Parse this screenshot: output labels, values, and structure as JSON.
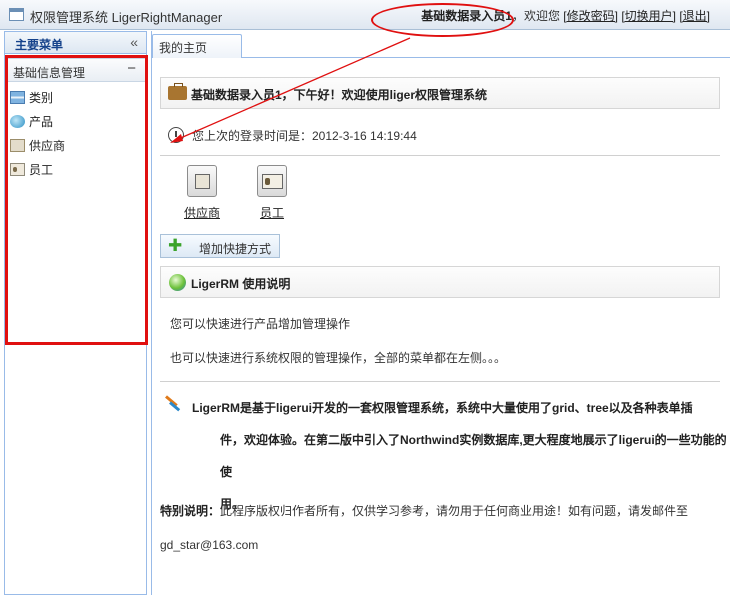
{
  "titlebar": {
    "app_title": "权限管理系统 LigerRightManager",
    "user_name": "基础数据录入员1",
    "welcome": "，欢迎您",
    "change_password": "[修改密码]",
    "switch_user": "[切换用户]",
    "logout": "[退出]"
  },
  "sidebar": {
    "title": "主要菜单",
    "collapse_glyph": "«",
    "group_title": "基础信息管理",
    "group_toggle": "−",
    "items": [
      {
        "label": "类别",
        "icon": "category-icon"
      },
      {
        "label": "产品",
        "icon": "product-icon"
      },
      {
        "label": "供应商",
        "icon": "supplier-icon"
      },
      {
        "label": "员工",
        "icon": "employee-icon"
      }
    ]
  },
  "main": {
    "tab_label": "我的主页",
    "greeting": "基础数据录入员1，下午好！欢迎使用liger权限管理系统",
    "last_login": "您上次的登录时间是：2012-3-16 14:19:44",
    "shortcuts": [
      {
        "label": "供应商",
        "icon": "supplier-icon"
      },
      {
        "label": "员工",
        "icon": "employee-icon"
      }
    ],
    "add_shortcut_label": "增加快捷方式",
    "usage_title": "LigerRM 使用说明",
    "usage_lines": [
      "您可以快速进行产品增加管理操作",
      "也可以快速进行系统权限的管理操作，全部的菜单都在左侧。。。"
    ],
    "intro_lines": [
      "LigerRM是基于ligerui开发的一套权限管理系统，系统中大量使用了grid、tree以及各种表单插",
      "件，欢迎体验。在第二版中引入了Northwind实例数据库,更大程度地展示了ligerui的一些功能的使",
      "用。"
    ],
    "note_label": "特别说明：",
    "note_text": "此程序版权归作者所有，仅供学习参考，请勿用于任何商业用途！如有问题，请发邮件至",
    "note_email": "gd_star@163.com"
  },
  "colors": {
    "annotation_red": "#e01010",
    "panel_border": "#99bbe8",
    "header_blue": "#15428b"
  }
}
